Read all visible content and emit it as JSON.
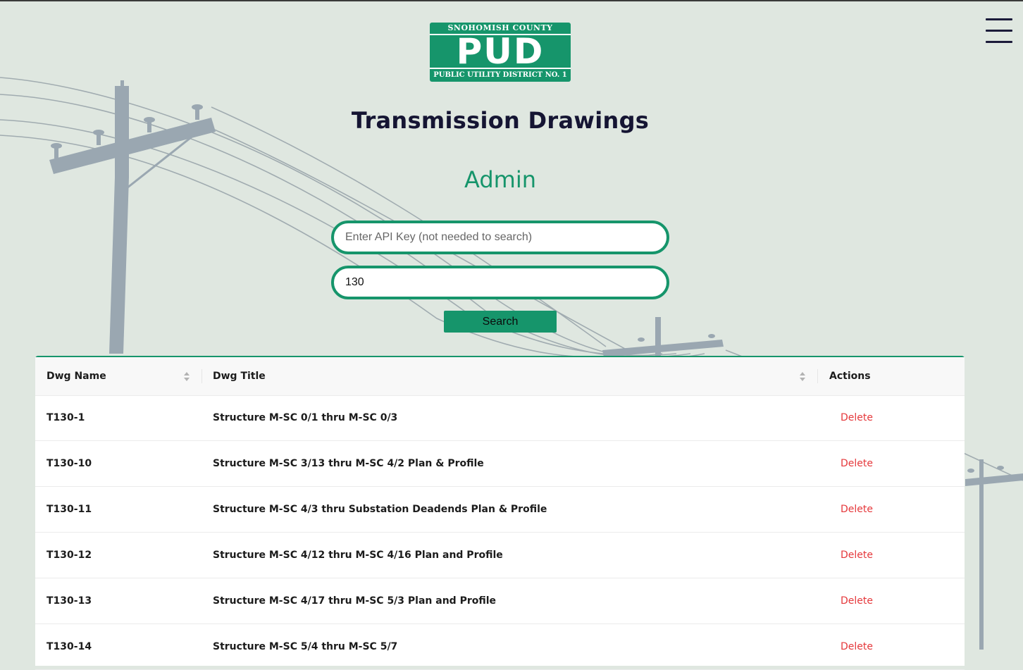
{
  "logo": {
    "top_text": "SNOHOMISH COUNTY",
    "main_text": "PUD",
    "bottom_text": "PUBLIC UTILITY DISTRICT NO. 1"
  },
  "header": {
    "title": "Transmission Drawings",
    "subtitle": "Admin",
    "menu_icon": "hamburger-menu-icon"
  },
  "form": {
    "api_key": {
      "placeholder": "Enter API Key (not needed to search)",
      "value": ""
    },
    "search": {
      "value": "130"
    },
    "search_button_label": "Search"
  },
  "table": {
    "columns": [
      {
        "label": "Dwg Name",
        "sortable": true
      },
      {
        "label": "Dwg Title",
        "sortable": true
      },
      {
        "label": "Actions",
        "sortable": false
      }
    ],
    "rows": [
      {
        "name": "T130-1",
        "title": "Structure M-SC 0/1 thru M-SC 0/3",
        "action": "Delete"
      },
      {
        "name": "T130-10",
        "title": "Structure M-SC 3/13 thru M-SC 4/2 Plan & Profile",
        "action": "Delete"
      },
      {
        "name": "T130-11",
        "title": "Structure M-SC 4/3 thru Substation Deadends Plan & Profile",
        "action": "Delete"
      },
      {
        "name": "T130-12",
        "title": "Structure M-SC 4/12 thru M-SC 4/16 Plan and Profile",
        "action": "Delete"
      },
      {
        "name": "T130-13",
        "title": "Structure M-SC 4/17 thru M-SC 5/3 Plan and Profile",
        "action": "Delete"
      },
      {
        "name": "T130-14",
        "title": "Structure M-SC 5/4 thru M-SC 5/7",
        "action": "Delete"
      }
    ]
  },
  "colors": {
    "brand_green": "#16956b",
    "title_navy": "#151533",
    "delete_red": "#e5383b",
    "background": "#dfe7e0"
  }
}
